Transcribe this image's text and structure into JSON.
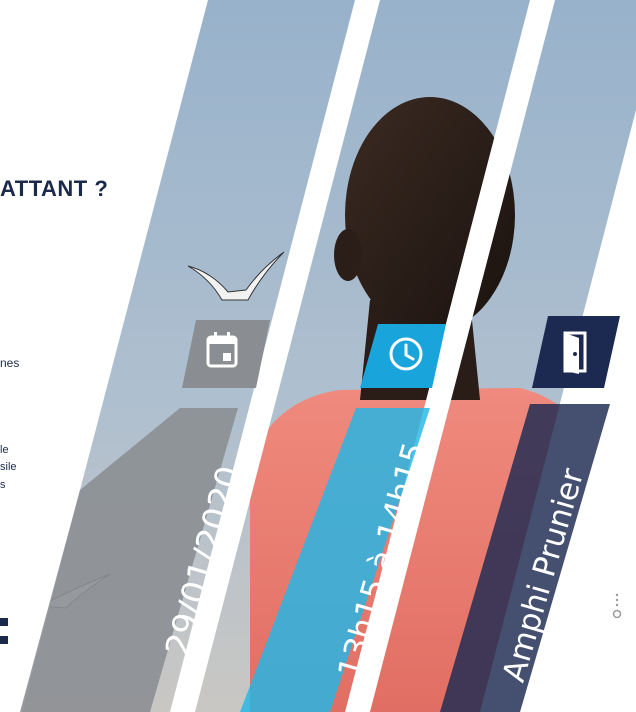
{
  "colors": {
    "navy": "#1b2a4a",
    "sky_top": "#9fb6cc",
    "sky_bottom": "#c8c9cb",
    "grey_tab": "#8a8d92",
    "cyan_tab": "#19a4dc",
    "navy_tab": "#1c2a52",
    "shirt": "#e87a6f"
  },
  "left": {
    "headline": "ATTANT ?",
    "fragment_1": "nes",
    "fragment_2": "le",
    "fragment_3": "sile",
    "fragment_4": "s"
  },
  "banners": {
    "date": {
      "icon": "calendar-icon",
      "label": "29/01/2020"
    },
    "time": {
      "icon": "clock-icon",
      "label": "13h15 à 14h15"
    },
    "room": {
      "icon": "door-icon",
      "label": "Amphi Prunier"
    }
  },
  "decor": {
    "scroll_hint_icon": "scroll-dots-icon"
  }
}
